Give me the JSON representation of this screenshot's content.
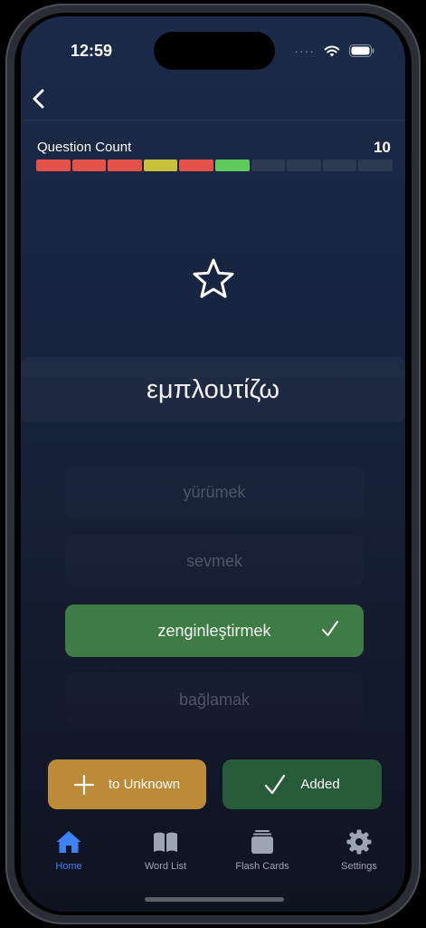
{
  "status_bar": {
    "time": "12:59",
    "signal_dots": "····"
  },
  "question": {
    "count_label": "Question Count",
    "count_value": "10",
    "progress_colors": [
      "#e5524a",
      "#e5524a",
      "#e5524a",
      "#c8c13a",
      "#e5524a",
      "#5fca5e",
      "#2e3a52",
      "#2e3a52",
      "#2e3a52",
      "#2e3a52"
    ]
  },
  "word": "εμπλουτίζω",
  "options": [
    {
      "label": "yürümek",
      "state": "dimmed"
    },
    {
      "label": "sevmek",
      "state": "dimmed"
    },
    {
      "label": "zenginleştirmek",
      "state": "correct"
    },
    {
      "label": "bağlamak",
      "state": "dimmed"
    }
  ],
  "actions": {
    "unknown_label": "to Unknown",
    "added_label": "Added"
  },
  "tabs": [
    {
      "label": "Home",
      "icon": "house-icon",
      "active": true
    },
    {
      "label": "Word List",
      "icon": "book-icon",
      "active": false
    },
    {
      "label": "Flash Cards",
      "icon": "cards-icon",
      "active": false
    },
    {
      "label": "Settings",
      "icon": "gear-icon",
      "active": false
    }
  ],
  "colors": {
    "accent": "#3d82f5",
    "correct": "#3f7c45",
    "unknown_button": "#bd8a37",
    "added_button": "#275b3a"
  }
}
